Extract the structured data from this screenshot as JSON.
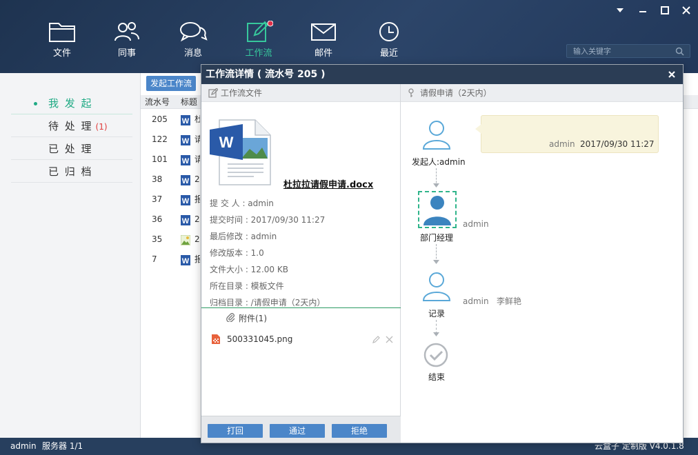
{
  "nav": [
    {
      "label": "文件",
      "icon": "folder-icon"
    },
    {
      "label": "同事",
      "icon": "colleagues-icon"
    },
    {
      "label": "消息",
      "icon": "chat-icon"
    },
    {
      "label": "工作流",
      "icon": "workflow-edit-icon",
      "active": true,
      "badge": true
    },
    {
      "label": "邮件",
      "icon": "mail-icon"
    },
    {
      "label": "最近",
      "icon": "clock-icon"
    }
  ],
  "search": {
    "placeholder": "输入关键字"
  },
  "sidebar": {
    "items": [
      {
        "label": "我 发 起",
        "active": true
      },
      {
        "label": "待 处 理",
        "count": "(1)"
      },
      {
        "label": "已 处 理"
      },
      {
        "label": "已 归 档"
      }
    ]
  },
  "list": {
    "start_button": "发起工作流",
    "col_no": "流水号",
    "col_title": "标题",
    "rows": [
      {
        "no": "205",
        "title": "杜",
        "type": "word"
      },
      {
        "no": "122",
        "title": "请",
        "type": "word"
      },
      {
        "no": "101",
        "title": "请",
        "type": "word"
      },
      {
        "no": "38",
        "title": "2",
        "type": "word"
      },
      {
        "no": "37",
        "title": "报",
        "type": "word"
      },
      {
        "no": "36",
        "title": "2",
        "type": "word"
      },
      {
        "no": "35",
        "title": "2",
        "type": "image"
      },
      {
        "no": "7",
        "title": "报",
        "type": "word"
      }
    ]
  },
  "status": {
    "user": "admin",
    "server": "服务器 1/1",
    "brand": "云盒子 定制版 V4.0.1.8"
  },
  "modal": {
    "title": "工作流详情 ( 流水号 205 )",
    "left_title": "工作流文件",
    "right_title": "请假申请（2天内）",
    "doc_name": "杜拉拉请假申请.docx",
    "meta": [
      "提 交 人 : admin",
      "提交时间 : 2017/09/30 11:27",
      "最后修改 : admin",
      "修改版本 : 1.0",
      "文件大小 : 12.00 KB",
      "所在目录 : 模板文件",
      "归档目录 : /请假申请（2天内）"
    ],
    "attachments_label": "附件(1)",
    "attachment_file": "500331045.png",
    "buttons": {
      "back": "打回",
      "pass": "通过",
      "reject": "拒绝"
    }
  },
  "flow": {
    "initiator": {
      "label": "发起人:admin"
    },
    "bubble": {
      "name": "admin",
      "time": "2017/09/30 11:27"
    },
    "manager": {
      "label": "部门经理",
      "name": "admin"
    },
    "record": {
      "label": "记录",
      "names": "admin   李鲜艳"
    },
    "end": {
      "label": "结束"
    }
  },
  "colors": {
    "accent": "#1faa84",
    "primary": "#4b86c9",
    "header": "#2b3d55",
    "badge": "#e0304a"
  }
}
